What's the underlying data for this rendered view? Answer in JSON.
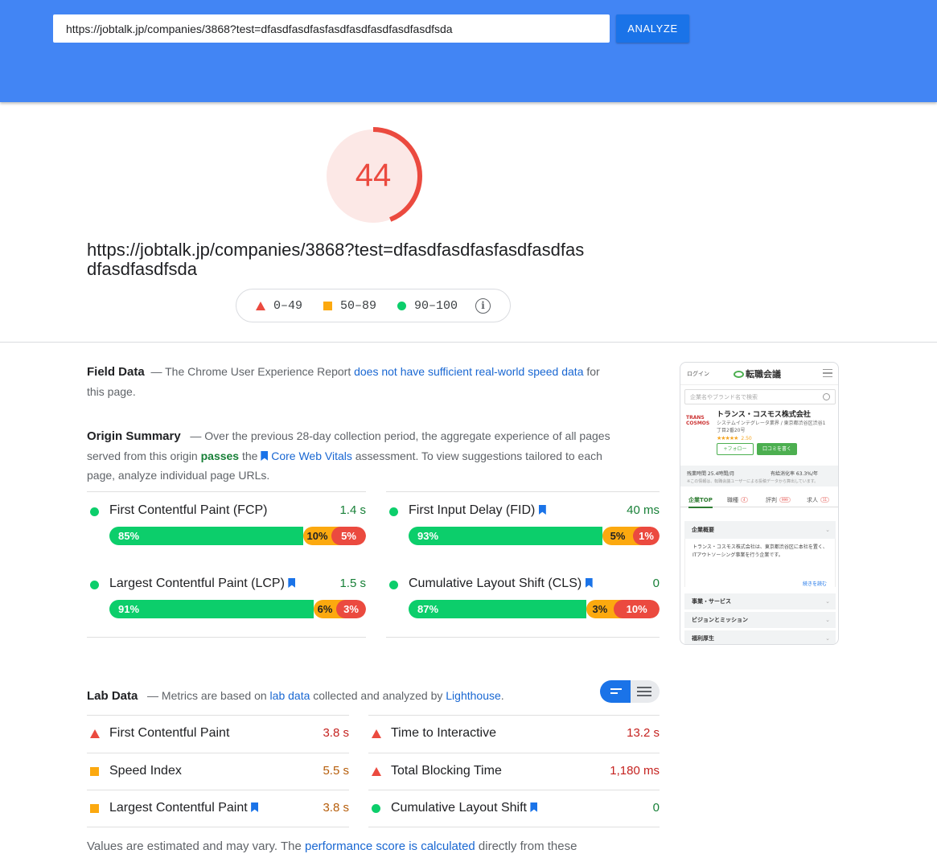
{
  "header": {
    "url_value": "https://jobtalk.jp/companies/3868?test=dfasdfasdfasfasdfasdfasdfasdfasdfsda",
    "analyze_label": "ANALYZE"
  },
  "score": {
    "value": "44",
    "fraction": 0.44,
    "color": "#eb4a3f",
    "tested_url": "https://jobtalk.jp/companies/3868?test=dfasdfasdfasfasdfasdfasdfasdfasdfsda"
  },
  "legend": {
    "poor": "0–49",
    "average": "50–89",
    "good": "90–100"
  },
  "field_data": {
    "title": "Field Data",
    "dash": "—",
    "text_pre": "The Chrome User Experience Report",
    "link": "does not have sufficient real-world speed data",
    "text_post": "for this page."
  },
  "origin_summary": {
    "title": "Origin Summary",
    "dash": "—",
    "text_pre": "Over the previous 28-day collection period, the aggregate experience of all pages served from this origin",
    "passes": "passes",
    "text_mid": "the",
    "cwv_link": "Core Web Vitals",
    "text_post": "assessment. To view suggestions tailored to each page, analyze individual page URLs.",
    "metrics": [
      {
        "name": "First Contentful Paint (FCP)",
        "value": "1.4 s",
        "good": "85%",
        "avg": "10%",
        "poor": "5%",
        "good_frac": 0.85,
        "avg_frac": 0.1,
        "poor_frac": 0.05
      },
      {
        "name": "First Input Delay (FID)",
        "value": "40 ms",
        "good": "93%",
        "avg": "5%",
        "poor": "1%",
        "good_frac": 0.93,
        "avg_frac": 0.05,
        "poor_frac": 0.01
      },
      {
        "name": "Largest Contentful Paint (LCP)",
        "value": "1.5 s",
        "good": "91%",
        "avg": "6%",
        "poor": "3%",
        "good_frac": 0.91,
        "avg_frac": 0.06,
        "poor_frac": 0.03
      },
      {
        "name": "Cumulative Layout Shift (CLS)",
        "value": "0",
        "good": "87%",
        "avg": "3%",
        "poor": "10%",
        "good_frac": 0.87,
        "avg_frac": 0.03,
        "poor_frac": 0.1
      }
    ]
  },
  "thumbnail": {
    "login": "ログイン",
    "logo": "転職会議",
    "search_placeholder": "企業名やブランド名で検索",
    "company_name": "トランス・コスモス株式会社",
    "company_desc": "システムインテグレータ業界 / 東京都渋谷区渋谷1丁目2番20号",
    "rating": "2.50",
    "follow": "+フォロー",
    "review": "口コミを書く",
    "stat1": "残業時間 25.4時間/月",
    "stat2": "有給消化率 63.3%/年",
    "stat_note": "※この情報は、転職会議ユーザーによる投稿データから算出しています。",
    "tabs": [
      "企業TOP",
      "職種",
      "評判",
      "求人"
    ],
    "tab_badges": [
      "",
      "4",
      "999",
      "11"
    ],
    "acc1": "企業概要",
    "body": "トランス・コスモス株式会社は、東京都渋谷区に本社を置く、ITアウトソーシング事業を行う企業です。",
    "more": "続きを読む",
    "acc2": "事業・サービス",
    "acc3": "ビジョンとミッション",
    "acc4": "福利厚生",
    "chevron": "⌄",
    "stars": "★★★★★",
    "company_logo": "TRANS COSMOS"
  },
  "lab_data": {
    "title": "Lab Data",
    "dash": "—",
    "text_pre": "Metrics are based on",
    "link1": "lab data",
    "text_mid": "collected and analyzed by",
    "link2": "Lighthouse",
    "text_post": ".",
    "metrics_left": [
      {
        "name": "First Contentful Paint",
        "value": "3.8 s",
        "icon": "triangle",
        "bookmark": false
      },
      {
        "name": "Speed Index",
        "value": "5.5 s",
        "icon": "square",
        "bookmark": false
      },
      {
        "name": "Largest Contentful Paint",
        "value": "3.8 s",
        "icon": "square",
        "bookmark": true
      }
    ],
    "metrics_right": [
      {
        "name": "Time to Interactive",
        "value": "13.2 s",
        "icon": "triangle",
        "bookmark": false
      },
      {
        "name": "Total Blocking Time",
        "value": "1,180 ms",
        "icon": "triangle",
        "bookmark": false
      },
      {
        "name": "Cumulative Layout Shift",
        "value": "0",
        "icon": "circle",
        "bookmark": true
      }
    ]
  },
  "footer": {
    "text_pre": "Values are estimated and may vary. The",
    "link": "performance score is calculated",
    "text_post": "directly from these"
  },
  "colors": {
    "header_blue": "#4285f4",
    "button_blue": "#1a73e8",
    "poor": "#eb4a3f",
    "average": "#fca90f",
    "good": "#0cce6b"
  }
}
